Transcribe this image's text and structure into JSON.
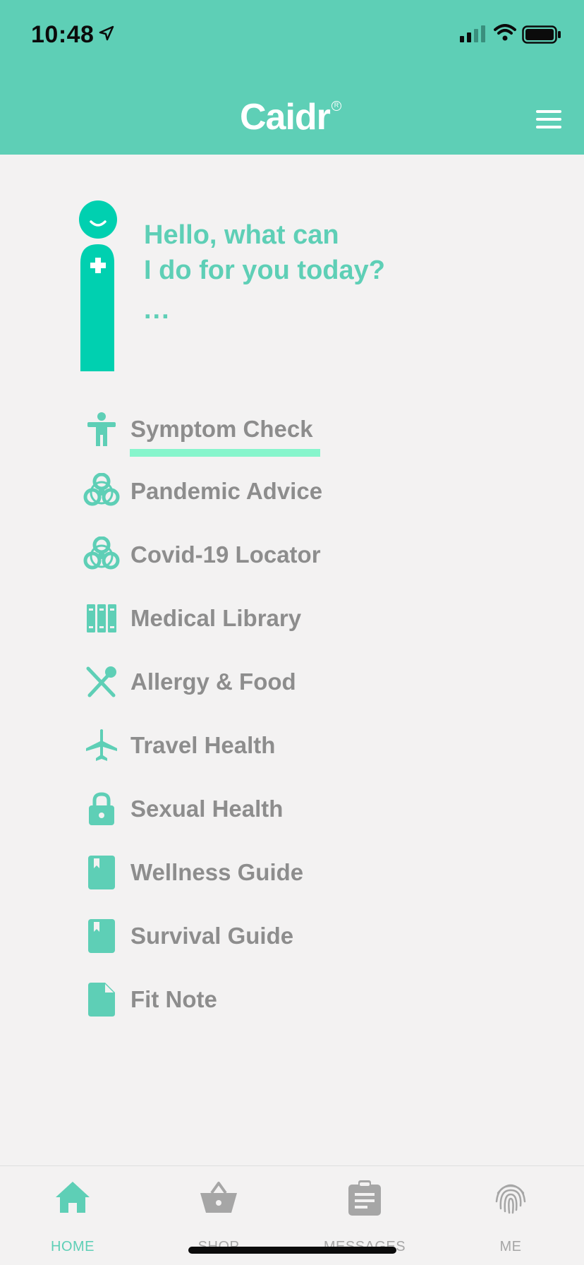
{
  "status_bar": {
    "time": "10:48"
  },
  "header": {
    "brand": "Caidr",
    "brand_mark": "R"
  },
  "greeting": {
    "line1": "Hello, what can",
    "line2": "I do for you today?",
    "dots": "..."
  },
  "menu": [
    {
      "label": "Symptom Check",
      "icon": "person-icon"
    },
    {
      "label": "Pandemic Advice",
      "icon": "biohazard-icon"
    },
    {
      "label": "Covid-19 Locator",
      "icon": "biohazard-icon"
    },
    {
      "label": "Medical Library",
      "icon": "books-icon"
    },
    {
      "label": "Allergy & Food",
      "icon": "utensils-icon"
    },
    {
      "label": "Travel Health",
      "icon": "plane-icon"
    },
    {
      "label": "Sexual Health",
      "icon": "lock-icon"
    },
    {
      "label": "Wellness Guide",
      "icon": "book-icon"
    },
    {
      "label": "Survival Guide",
      "icon": "book-icon"
    },
    {
      "label": "Fit Note",
      "icon": "document-icon"
    }
  ],
  "tabs": [
    {
      "label": "HOME",
      "icon": "home-icon",
      "active": true
    },
    {
      "label": "SHOP",
      "icon": "basket-icon",
      "active": false
    },
    {
      "label": "MESSAGES",
      "icon": "clipboard-icon",
      "active": false
    },
    {
      "label": "ME",
      "icon": "fingerprint-icon",
      "active": false
    }
  ],
  "colors": {
    "accent": "#5ecfb6",
    "mascot": "#00d0b0",
    "highlight": "#86f5cc",
    "text_muted": "#8d8d8d",
    "background": "#f3f2f2"
  }
}
